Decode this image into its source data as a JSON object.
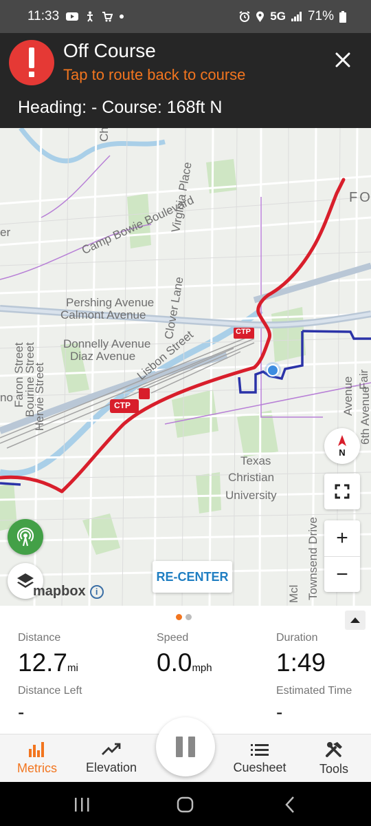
{
  "status_bar": {
    "time": "11:33",
    "network": "5G",
    "battery": "71%"
  },
  "banner": {
    "title": "Off Course",
    "subtitle": "Tap to route back to course",
    "heading": "Heading: - Course: 168ft N"
  },
  "map": {
    "labels": {
      "camp_bowie": "Camp Bowie Boulevard",
      "virginia": "Virginia Place",
      "pershing": "Pershing Avenue",
      "calmont": "Calmont Avenue",
      "donnelly": "Donnelly Avenue",
      "diaz": "Diaz Avenue",
      "clover": "Clover Lane",
      "lisbon": "Lisbon Street",
      "faron": "Faron Street",
      "bourine": "Bourine Street",
      "hervie": "Hervie Street",
      "texas1": "Texas",
      "texas2": "Christian",
      "texas3": "University",
      "townsend": "Townsend Drive",
      "sixth": "6th Avenue",
      "ave": "Avenue",
      "fo": "FO",
      "er": "er",
      "no": "no",
      "ch": "Ch",
      "fair": "Fair",
      "ctp1": "CTP",
      "ctp2": "CTP",
      "mcl": "Mcl"
    },
    "compass_label": "N",
    "recenter_label": "RE-CENTER",
    "zoom_in": "+",
    "zoom_out": "−",
    "attribution": "mapbox"
  },
  "metrics": {
    "distance": {
      "label": "Distance",
      "value": "12.7",
      "unit": "mi"
    },
    "speed": {
      "label": "Speed",
      "value": "0.0",
      "unit": "mph"
    },
    "duration": {
      "label": "Duration",
      "value": "1:49"
    },
    "distance_left": {
      "label": "Distance Left",
      "value": "-"
    },
    "estimated_time": {
      "label": "Estimated Time",
      "value": "-"
    }
  },
  "bottom_nav": {
    "metrics": "Metrics",
    "elevation": "Elevation",
    "cuesheet": "Cuesheet",
    "tools": "Tools"
  },
  "colors": {
    "accent": "#f2751f",
    "route_red": "#d81e2b",
    "route_blue": "#2b33a8",
    "alert_red": "#e53935"
  }
}
